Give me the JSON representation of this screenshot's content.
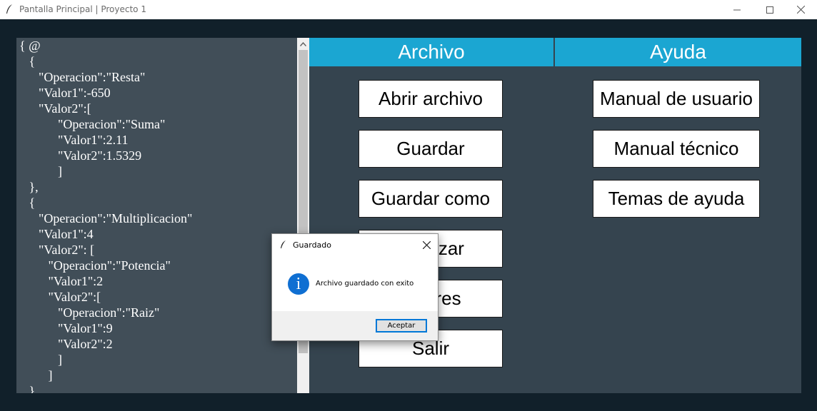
{
  "window": {
    "title": "Pantalla Principal | Proyecto 1"
  },
  "editor": {
    "lines": [
      "{ @",
      "   {",
      "      \"Operacion\":\"Resta\"",
      "      \"Valor1\":-650",
      "      \"Valor2\":[",
      "            \"Operacion\":\"Suma\"",
      "            \"Valor1\":2.11",
      "            \"Valor2\":1.5329",
      "            ]",
      "   },",
      "   {",
      "      \"Operacion\":\"Multiplicacion\"",
      "      \"Valor1\":4",
      "      \"Valor2\": [",
      "         \"Operacion\":\"Potencia\"",
      "         \"Valor1\":2",
      "         \"Valor2\":[",
      "            \"Operacion\":\"Raiz\"",
      "            \"Valor1\":9",
      "            \"Valor2\":2",
      "            ]",
      "         ]",
      "   }"
    ]
  },
  "menus": {
    "archivo": {
      "title": "Archivo",
      "items": [
        "Abrir archivo",
        "Guardar",
        "Guardar como",
        "Analizar",
        "Errores",
        "Salir"
      ]
    },
    "ayuda": {
      "title": "Ayuda",
      "items": [
        "Manual de usuario",
        "Manual técnico",
        "Temas de ayuda"
      ]
    }
  },
  "dialog": {
    "title": "Guardado",
    "message": "Archivo guardado con exito",
    "ok_label": "Aceptar",
    "icon": "info-icon"
  },
  "colors": {
    "background": "#11202a",
    "panel": "#35444f",
    "editor": "#414e58",
    "header": "#1ba6d2",
    "dialog_accent": "#0078d7"
  }
}
